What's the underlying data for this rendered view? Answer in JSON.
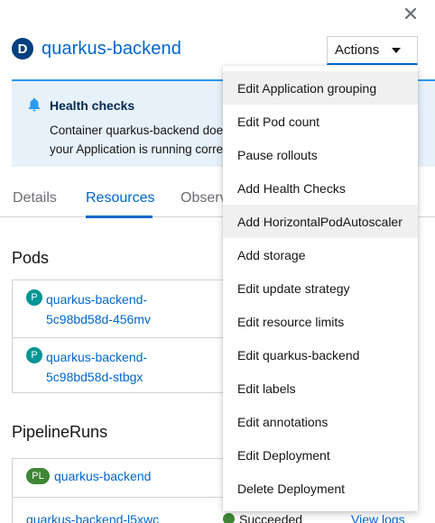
{
  "header": {
    "badge": "D",
    "title": "quarkus-backend",
    "close_icon": "close-icon"
  },
  "actions": {
    "label": "Actions",
    "menu": [
      "Edit Application grouping",
      "Edit Pod count",
      "Pause rollouts",
      "Add Health Checks",
      "Add HorizontalPodAutoscaler",
      "Add storage",
      "Edit update strategy",
      "Edit resource limits",
      "Edit quarkus-backend",
      "Edit labels",
      "Edit annotations",
      "Edit Deployment",
      "Delete Deployment"
    ]
  },
  "alert": {
    "title": "Health checks",
    "line1": "Container quarkus-backend does",
    "line2": "your Application is running correc"
  },
  "tabs": [
    "Details",
    "Resources",
    "Observ"
  ],
  "pods": {
    "title": "Pods",
    "badge": "P",
    "items": [
      {
        "line1": "quarkus-backend-",
        "line2": "5c98bd58d-456mv"
      },
      {
        "line1": "quarkus-backend-",
        "line2": "5c98bd58d-stbgx"
      }
    ]
  },
  "pipelineruns": {
    "title": "PipelineRuns",
    "badge": "PL",
    "pipeline": "quarkus-backend",
    "run": "quarkus-backend-l5xwc",
    "status": "Succeeded",
    "logs": "View logs"
  },
  "colors": {
    "accent": "#06c",
    "alert_bg": "#e7f1fa",
    "success": "#3e8635"
  }
}
